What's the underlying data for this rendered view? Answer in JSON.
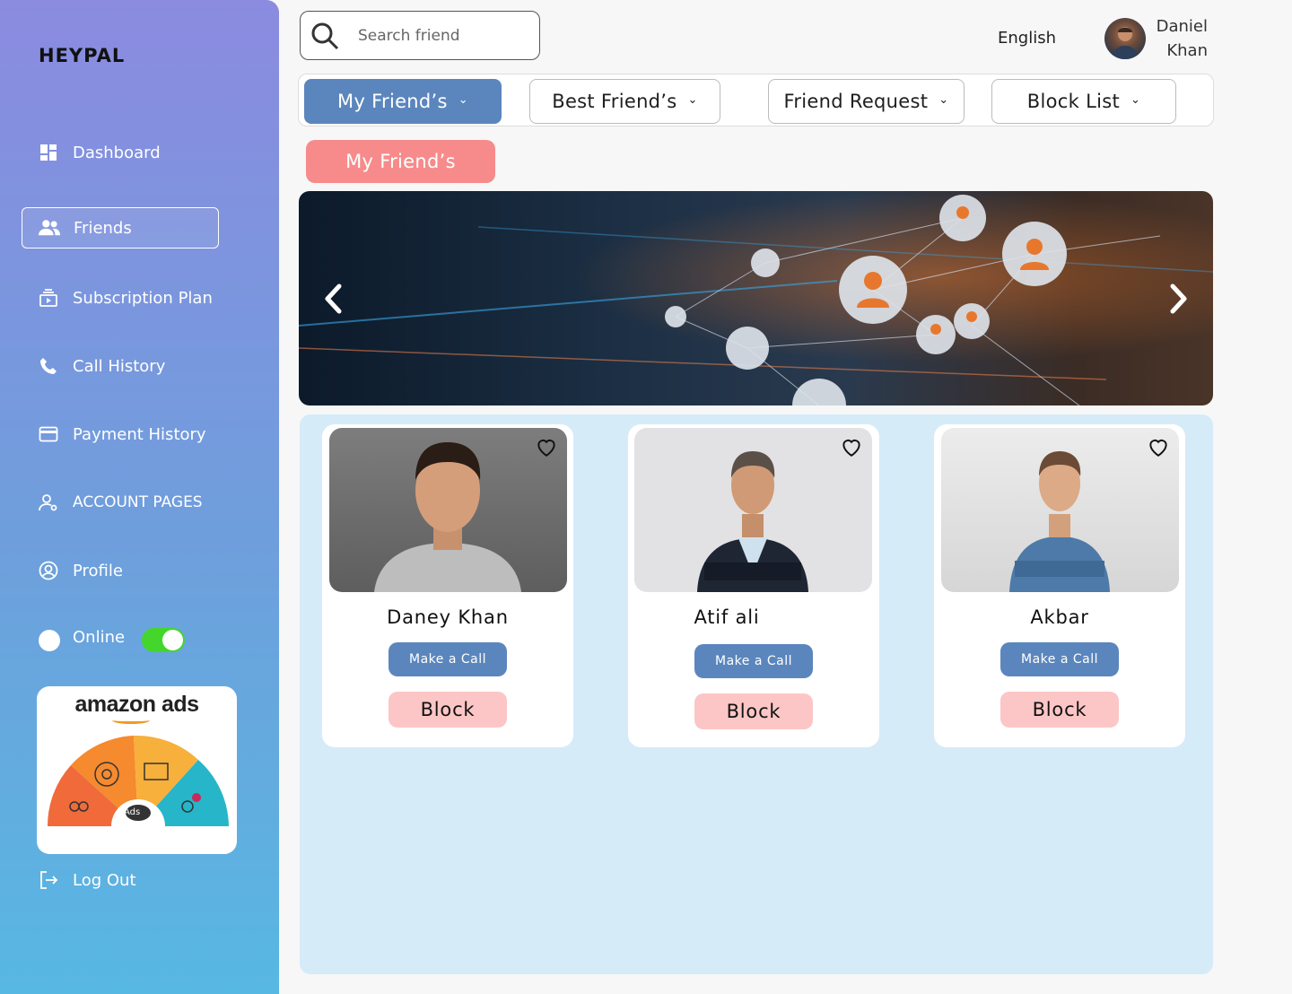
{
  "app": {
    "brand": "HEYPAL"
  },
  "sidebar": {
    "items": [
      {
        "label": "Dashboard",
        "icon": "dashboard-icon"
      },
      {
        "label": "Friends",
        "icon": "friends-icon",
        "active": true
      },
      {
        "label": "Subscription Plan",
        "icon": "subscription-icon"
      },
      {
        "label": "Call History",
        "icon": "phone-icon"
      },
      {
        "label": "Payment History",
        "icon": "credit-card-icon"
      },
      {
        "label": "ACCOUNT PAGES",
        "icon": "account-icon"
      },
      {
        "label": "Profile",
        "icon": "profile-icon"
      }
    ],
    "status": {
      "label": "Online",
      "enabled": true
    },
    "ad": {
      "brand": "amazon ads",
      "badge": "Ads"
    },
    "logout_label": "Log Out"
  },
  "header": {
    "search_placeholder": "Search friend",
    "language": "English",
    "user": {
      "first_name": "Daniel",
      "last_name": "Khan"
    }
  },
  "tabs": [
    {
      "label": "My Friend’s",
      "active": true
    },
    {
      "label": "Best Friend’s"
    },
    {
      "label": "Friend Request"
    },
    {
      "label": "Block List"
    }
  ],
  "section_title": "My Friend’s",
  "friends": [
    {
      "name": "Daney Khan",
      "call_label": "Make a Call",
      "block_label": "Block"
    },
    {
      "name": "Atif ali",
      "call_label": "Make a Call",
      "block_label": "Block"
    },
    {
      "name": "Akbar",
      "call_label": "Make a Call",
      "block_label": "Block"
    }
  ],
  "colors": {
    "accent_blue": "#5b86bd",
    "pill_red": "#f78b8b",
    "block_pink": "#fcc6c6",
    "toggle_green": "#44d62c",
    "cards_bg": "#d6ebf8"
  }
}
